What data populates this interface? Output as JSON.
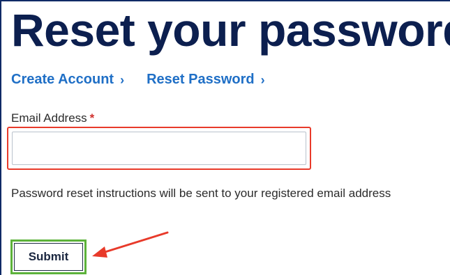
{
  "page": {
    "title": "Reset your password"
  },
  "breadcrumb": {
    "items": [
      {
        "label": "Create Account",
        "chevron": "›"
      },
      {
        "label": "Reset Password",
        "chevron": "›"
      }
    ]
  },
  "form": {
    "email_label": "Email Address",
    "required_marker": "*",
    "email_value": "",
    "email_placeholder": "",
    "help_text": "Password reset instructions will be sent to your registered email address",
    "submit_label": "Submit"
  },
  "annotations": {
    "email_highlight_color": "#e83a2a",
    "submit_highlight_color": "#5cb23a",
    "arrow_color": "#e83a2a"
  },
  "colors": {
    "title": "#0c1f4f",
    "link": "#1f6fc6",
    "required": "#d0312d"
  }
}
